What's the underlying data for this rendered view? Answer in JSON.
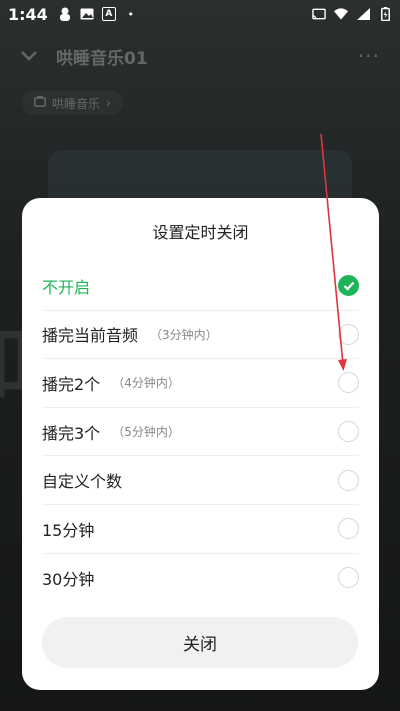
{
  "status_bar": {
    "time": "1:44",
    "a_icon": "A"
  },
  "top_bar": {
    "title": "哄睡音乐01"
  },
  "playlist": {
    "label": "哄睡音乐"
  },
  "dialog": {
    "title": "设置定时关闭",
    "options": [
      {
        "label": "不开启",
        "sub": "",
        "selected": true
      },
      {
        "label": "播完当前音频",
        "sub": "（3分钟内）",
        "selected": false
      },
      {
        "label": "播完2个",
        "sub": "（4分钟内）",
        "selected": false
      },
      {
        "label": "播完3个",
        "sub": "（5分钟内）",
        "selected": false
      },
      {
        "label": "自定义个数",
        "sub": "",
        "selected": false
      },
      {
        "label": "15分钟",
        "sub": "",
        "selected": false
      },
      {
        "label": "30分钟",
        "sub": "",
        "selected": false
      }
    ],
    "close_label": "关闭"
  },
  "colors": {
    "accent": "#20b45a",
    "annotation": "#e0343c"
  }
}
